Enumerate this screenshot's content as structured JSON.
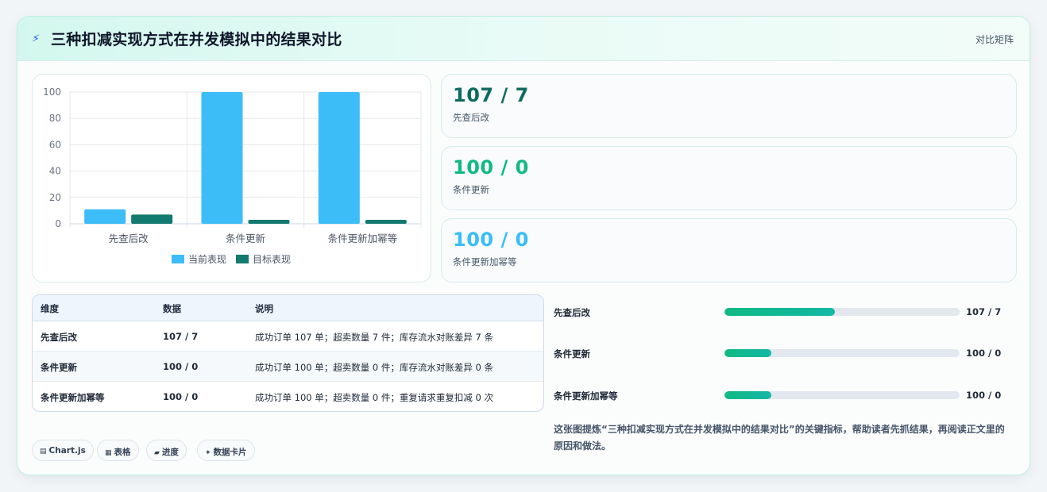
{
  "header": {
    "title": "三种扣减实现方式在并发模拟中的结果对比",
    "tag": "对比矩阵"
  },
  "chart_data": {
    "type": "bar",
    "categories": [
      "先查后改",
      "条件更新",
      "条件更新加幂等"
    ],
    "series": [
      {
        "name": "当前表现",
        "values": [
          11,
          100,
          100
        ],
        "color": "#3dbdf8"
      },
      {
        "name": "目标表现",
        "values": [
          7,
          3,
          3
        ],
        "color": "#127a6e"
      }
    ],
    "y_ticks": [
      0,
      20,
      40,
      60,
      80,
      100
    ],
    "ylim": [
      0,
      100
    ],
    "legend": "bottom",
    "grid": true
  },
  "stats": [
    {
      "value": "107 / 7",
      "label": "先查后改",
      "color": "#0f6b5f"
    },
    {
      "value": "100 / 0",
      "label": "条件更新",
      "color": "#10b981"
    },
    {
      "value": "100 / 0",
      "label": "条件更新加幂等",
      "color": "#38bdf8"
    }
  ],
  "table": {
    "headers": [
      "维度",
      "数据",
      "说明"
    ],
    "rows": [
      [
        "先查后改",
        "107 / 7",
        "成功订单 107 单；超卖数量 7 件；库存流水对账差异 7 条"
      ],
      [
        "条件更新",
        "100 / 0",
        "成功订单 100 单；超卖数量 0 件；库存流水对账差异 0 条"
      ],
      [
        "条件更新加幂等",
        "100 / 0",
        "成功订单 100 单；超卖数量 0 件；重复请求重复扣减 0 次"
      ]
    ]
  },
  "progress": [
    {
      "label": "先查后改",
      "value": "107 / 7",
      "fraction": 0.47
    },
    {
      "label": "条件更新",
      "value": "100 / 0",
      "fraction": 0.2
    },
    {
      "label": "条件更新加幂等",
      "value": "100 / 0",
      "fraction": 0.2
    }
  ],
  "note": "这张图提炼“三种扣减实现方式在并发模拟中的结果对比”的关键指标，帮助读者先抓结果，再阅读正文里的原因和做法。",
  "pills": [
    {
      "icon": "▤",
      "icon_name": "chart-icon",
      "label": "Chart.js"
    },
    {
      "icon": "▦",
      "icon_name": "table-icon",
      "label": "表格"
    },
    {
      "icon": "▰",
      "icon_name": "progress-icon",
      "label": "进度"
    },
    {
      "icon": "✦",
      "icon_name": "sparkle-icon",
      "label": "数据卡片"
    }
  ]
}
